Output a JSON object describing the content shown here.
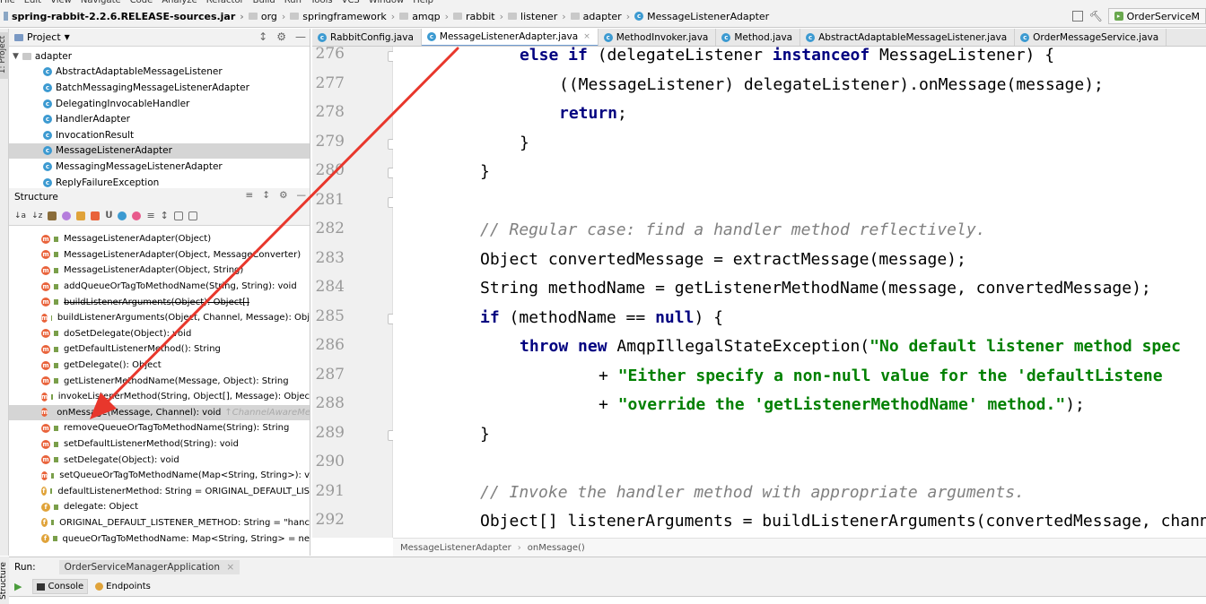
{
  "menubar": [
    "File",
    "Edit",
    "View",
    "Navigate",
    "Code",
    "Analyze",
    "Refactor",
    "Build",
    "Run",
    "Tools",
    "VCS",
    "Window",
    "Help"
  ],
  "breadcrumbs": [
    "spring-rabbit-2.2.6.RELEASE-sources.jar",
    "org",
    "springframework",
    "amqp",
    "rabbit",
    "listener",
    "adapter",
    "MessageListenerAdapter"
  ],
  "run_config": "OrderServiceM",
  "left_strip_label": "1: Project",
  "bottom_strip_label": "Structure",
  "project_panel": {
    "title": "Project",
    "package": "adapter",
    "items": [
      "AbstractAdaptableMessageListener",
      "BatchMessagingMessageListenerAdapter",
      "DelegatingInvocableHandler",
      "HandlerAdapter",
      "InvocationResult",
      "MessageListenerAdapter",
      "MessagingMessageListenerAdapter",
      "ReplyFailureException"
    ],
    "selected_index": 5
  },
  "structure_panel": {
    "title": "Structure",
    "members": [
      {
        "kind": "m",
        "text": "MessageListenerAdapter(Object)"
      },
      {
        "kind": "m",
        "text": "MessageListenerAdapter(Object, MessageConverter)"
      },
      {
        "kind": "m",
        "text": "MessageListenerAdapter(Object, String)"
      },
      {
        "kind": "m",
        "text": "addQueueOrTagToMethodName(String, String): void"
      },
      {
        "kind": "m",
        "text": "buildListenerArguments(Object): Object[]",
        "strike": true
      },
      {
        "kind": "m",
        "text": "buildListenerArguments(Object, Channel, Message): Obj"
      },
      {
        "kind": "m",
        "text": "doSetDelegate(Object): void"
      },
      {
        "kind": "m",
        "text": "getDefaultListenerMethod(): String"
      },
      {
        "kind": "m",
        "text": "getDelegate(): Object"
      },
      {
        "kind": "m",
        "text": "getListenerMethodName(Message, Object): String"
      },
      {
        "kind": "m",
        "text": "invokeListenerMethod(String, Object[], Message): Objec"
      },
      {
        "kind": "m",
        "text": "onMessage(Message, Channel): void",
        "hint": "↑ChannelAwareMe"
      },
      {
        "kind": "m",
        "text": "removeQueueOrTagToMethodName(String): String"
      },
      {
        "kind": "m",
        "text": "setDefaultListenerMethod(String): void"
      },
      {
        "kind": "m",
        "text": "setDelegate(Object): void"
      },
      {
        "kind": "m",
        "text": "setQueueOrTagToMethodName(Map<String, String>): v"
      },
      {
        "kind": "f",
        "text": "defaultListenerMethod: String = ORIGINAL_DEFAULT_LIS"
      },
      {
        "kind": "f",
        "text": "delegate: Object"
      },
      {
        "kind": "f",
        "text": "ORIGINAL_DEFAULT_LISTENER_METHOD: String = \"hanc"
      },
      {
        "kind": "f",
        "text": "queueOrTagToMethodName: Map<String, String> = ne"
      }
    ],
    "selected_index": 11
  },
  "editor_tabs": [
    {
      "label": "RabbitConfig.java",
      "active": false
    },
    {
      "label": "MessageListenerAdapter.java",
      "active": true
    },
    {
      "label": "MethodInvoker.java",
      "active": false
    },
    {
      "label": "Method.java",
      "active": false
    },
    {
      "label": "AbstractAdaptableMessageListener.java",
      "active": false
    },
    {
      "label": "OrderMessageService.java",
      "active": false
    }
  ],
  "code_lines": [
    {
      "n": "276",
      "indent": 1,
      "parts": [
        [
          "kw",
          "else if "
        ],
        [
          "",
          "(delegateListener "
        ],
        [
          "kw",
          "instanceof "
        ],
        [
          "",
          "MessageListener) {"
        ]
      ]
    },
    {
      "n": "277",
      "indent": 2,
      "parts": [
        [
          "",
          "((MessageListener) delegateListener).onMessage(message);"
        ]
      ]
    },
    {
      "n": "278",
      "indent": 2,
      "parts": [
        [
          "kw",
          "return"
        ],
        [
          "",
          ";"
        ]
      ]
    },
    {
      "n": "279",
      "indent": 1,
      "parts": [
        [
          "",
          "}"
        ]
      ]
    },
    {
      "n": "280",
      "indent": 0,
      "parts": [
        [
          "",
          "}"
        ]
      ]
    },
    {
      "n": "281",
      "indent": 0,
      "parts": []
    },
    {
      "n": "282",
      "indent": 0,
      "parts": [
        [
          "cm",
          "// Regular case: find a handler method reflectively."
        ]
      ]
    },
    {
      "n": "283",
      "indent": 0,
      "parts": [
        [
          "",
          "Object convertedMessage = extractMessage(message);"
        ]
      ]
    },
    {
      "n": "284",
      "indent": 0,
      "parts": [
        [
          "",
          "String methodName = getListenerMethodName(message, convertedMessage);"
        ]
      ]
    },
    {
      "n": "285",
      "indent": 0,
      "parts": [
        [
          "kw",
          "if "
        ],
        [
          "",
          "(methodName == "
        ],
        [
          "kw",
          "null"
        ],
        [
          "",
          ") {"
        ]
      ]
    },
    {
      "n": "286",
      "indent": 1,
      "parts": [
        [
          "kw",
          "throw new "
        ],
        [
          "",
          "AmqpIllegalStateException("
        ],
        [
          "st",
          "\"No default listener method spec"
        ]
      ]
    },
    {
      "n": "287",
      "indent": 3,
      "parts": [
        [
          "",
          "+ "
        ],
        [
          "st",
          "\"Either specify a non-null value for the 'defaultListene"
        ]
      ]
    },
    {
      "n": "288",
      "indent": 3,
      "parts": [
        [
          "",
          "+ "
        ],
        [
          "st",
          "\"override the 'getListenerMethodName' method.\""
        ],
        [
          "",
          ");"
        ]
      ]
    },
    {
      "n": "289",
      "indent": 0,
      "parts": [
        [
          "",
          "}"
        ]
      ]
    },
    {
      "n": "290",
      "indent": 0,
      "parts": []
    },
    {
      "n": "291",
      "indent": 0,
      "parts": [
        [
          "cm",
          "// Invoke the handler method with appropriate arguments."
        ]
      ]
    },
    {
      "n": "292",
      "indent": 0,
      "parts": [
        [
          "",
          "Object[] listenerArguments = buildListenerArguments(convertedMessage, chann"
        ]
      ]
    }
  ],
  "editor_breadcrumb": [
    "MessageListenerAdapter",
    "onMessage()"
  ],
  "run_panel": {
    "label": "Run:",
    "tab": "OrderServiceManagerApplication"
  },
  "console_tabs": [
    "Console",
    "Endpoints"
  ],
  "colors": {
    "keyword": "#000080",
    "string": "#008000",
    "comment": "#808080",
    "annotation_arrow": "#e8372c",
    "selection": "#d5d5d5"
  }
}
